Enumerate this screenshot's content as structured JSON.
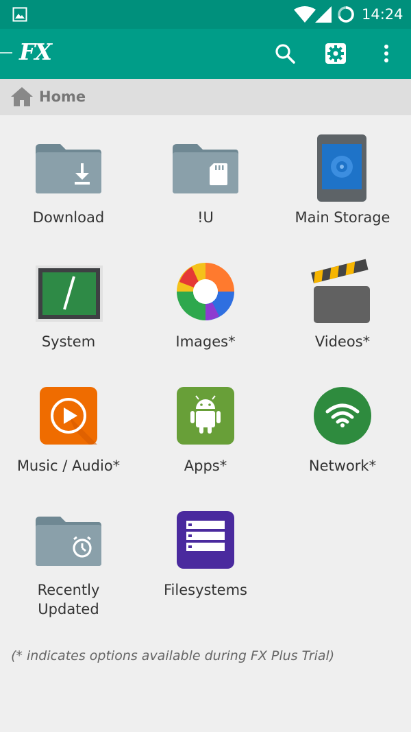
{
  "status_bar": {
    "time": "14:24",
    "icons": [
      "image-notification-icon",
      "wifi-icon",
      "signal-icon",
      "battery-icon"
    ]
  },
  "app_bar": {
    "logo": "FX",
    "actions": [
      "search-icon",
      "settings-icon",
      "more-vert-icon"
    ],
    "color": "#009d88"
  },
  "breadcrumb": {
    "icon": "home-icon",
    "label": "Home"
  },
  "items": [
    {
      "label": "Download",
      "icon": "folder-download-icon"
    },
    {
      "label": "!U",
      "icon": "folder-sdcard-icon"
    },
    {
      "label": "Main Storage",
      "icon": "phone-storage-icon"
    },
    {
      "label": "System",
      "icon": "terminal-icon"
    },
    {
      "label": "Images*",
      "icon": "images-icon"
    },
    {
      "label": "Videos*",
      "icon": "clapperboard-icon"
    },
    {
      "label": "Music / Audio*",
      "icon": "play-audio-icon"
    },
    {
      "label": "Apps*",
      "icon": "android-icon"
    },
    {
      "label": "Network*",
      "icon": "network-wifi-icon"
    },
    {
      "label": "Recently Updated",
      "label_lines": [
        "Recently",
        "Updated"
      ],
      "icon": "folder-clock-icon"
    },
    {
      "label": "Filesystems",
      "icon": "filesystems-icon"
    }
  ],
  "footnote": "(* indicates options available during FX Plus Trial)"
}
